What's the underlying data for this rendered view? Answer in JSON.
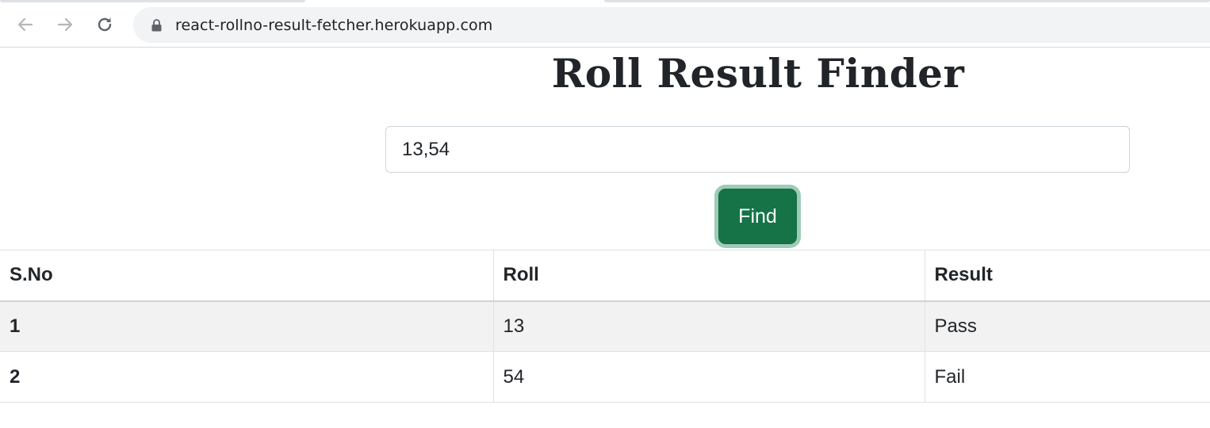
{
  "browser": {
    "url": "react-rollno-result-fetcher.herokuapp.com",
    "icons": [
      "back-arrow-icon",
      "forward-arrow-icon",
      "reload-icon",
      "lock-icon"
    ]
  },
  "page": {
    "title": "Roll Result Finder",
    "roll_input_value": "13,54",
    "find_button_label": "Find"
  },
  "table": {
    "headers": {
      "sno": "S.No",
      "roll": "Roll",
      "result": "Result"
    },
    "rows": [
      {
        "sno": "1",
        "roll": "13",
        "result": "Pass"
      },
      {
        "sno": "2",
        "roll": "54",
        "result": "Fail"
      }
    ]
  },
  "colors": {
    "button": "#157347",
    "button_focus_ring": "#8fc5ab",
    "striped_row": "#f2f2f2"
  }
}
